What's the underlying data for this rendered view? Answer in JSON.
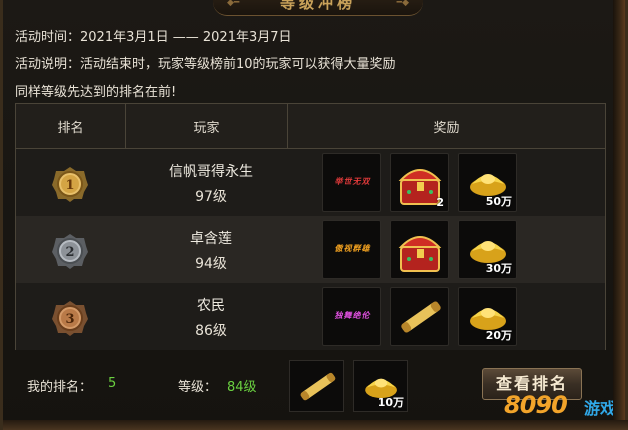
{
  "header": {
    "title": "等级冲榜"
  },
  "info": {
    "time_label": "活动时间：2021年3月1日 —— 2021年3月7日",
    "desc_label": "活动说明：活动结束时，玩家等级榜前10的玩家可以获得大量奖励",
    "note": "同样等级先达到的排名在前!"
  },
  "table": {
    "headers": [
      "排名",
      "玩家",
      "奖励"
    ],
    "rows": [
      {
        "rank": "1",
        "medal": "gold-medal-icon",
        "name": "信帆哥得永生",
        "level": "97级",
        "rewards": [
          {
            "icon": "title-badge-icon",
            "text": "举世无双",
            "qty": "",
            "color": "#e03a3a"
          },
          {
            "icon": "treasure-chest-icon",
            "qty": "2"
          },
          {
            "icon": "gold-ingot-icon",
            "qty": "50万"
          }
        ]
      },
      {
        "rank": "2",
        "medal": "silver-medal-icon",
        "name": "卓含莲",
        "level": "94级",
        "rewards": [
          {
            "icon": "title-badge-icon",
            "text": "傲视群雄",
            "qty": "",
            "color": "#f0a020"
          },
          {
            "icon": "treasure-chest-icon",
            "qty": ""
          },
          {
            "icon": "gold-ingot-icon",
            "qty": "30万"
          }
        ]
      },
      {
        "rank": "3",
        "medal": "bronze-medal-icon",
        "name": "农民",
        "level": "86级",
        "rewards": [
          {
            "icon": "title-badge-icon",
            "text": "独舞绝伦",
            "qty": "",
            "color": "#e050e0"
          },
          {
            "icon": "scroll-icon",
            "qty": ""
          },
          {
            "icon": "gold-ingot-icon",
            "qty": "20万"
          }
        ]
      }
    ]
  },
  "mine": {
    "rank_label": "我的排名：",
    "rank_value": "5",
    "level_label": "等级：",
    "level_value": "84级",
    "rewards": [
      {
        "icon": "scroll-icon",
        "qty": ""
      },
      {
        "icon": "gold-ingot-icon",
        "qty": "10万"
      }
    ],
    "button": "查看排名"
  },
  "watermark": {
    "logo": "8090",
    "text": "游戏"
  },
  "colors": {
    "accent": "#c9a25a",
    "green": "#6ad040",
    "watermark_blue": "#30a8e8",
    "watermark_orange": "#f2a42a"
  }
}
